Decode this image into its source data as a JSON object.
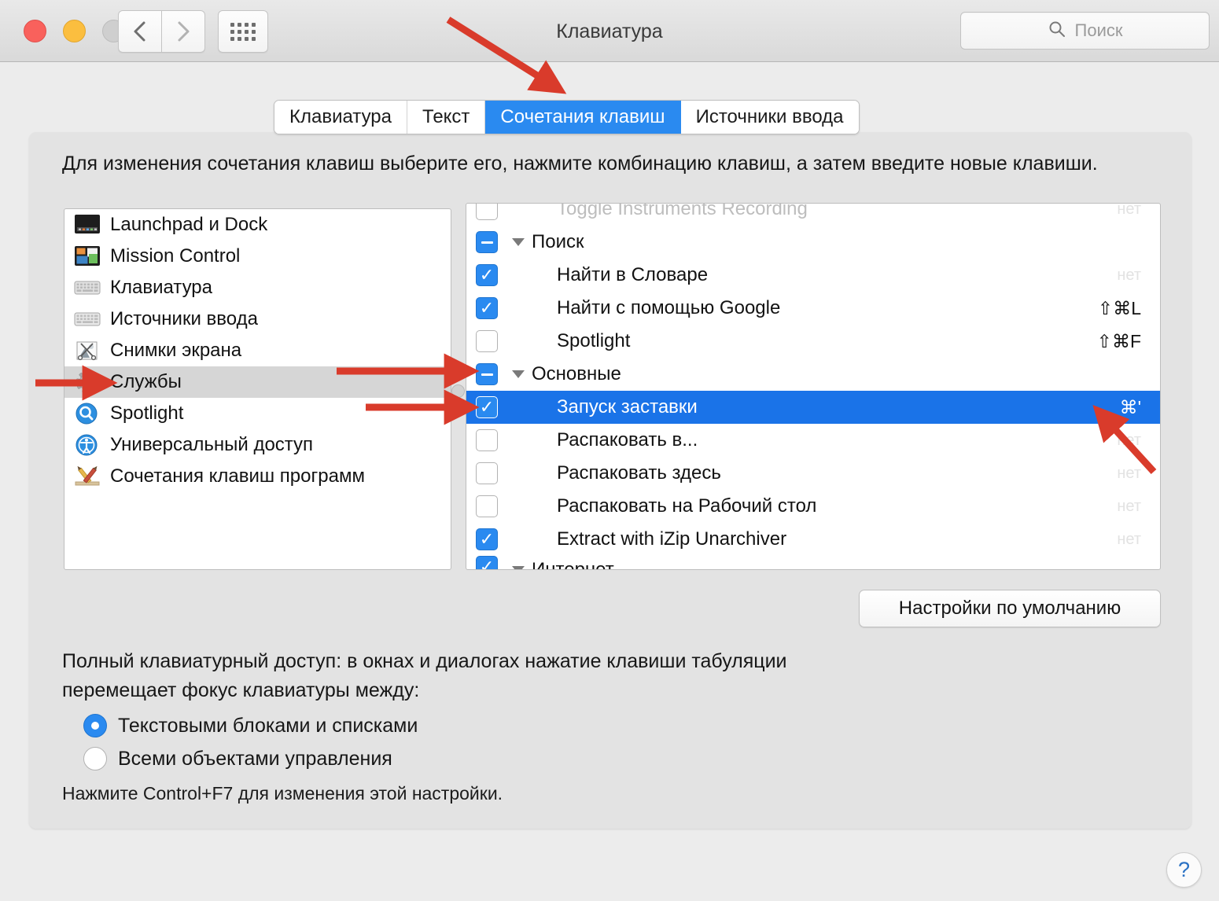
{
  "window": {
    "title": "Клавиатура",
    "traffic_lights": [
      "close",
      "minimize",
      "zoom"
    ],
    "nav": {
      "back": "back-chevron",
      "forward": "forward-chevron",
      "grid": "show-all-grid"
    },
    "search": {
      "placeholder": "Поиск",
      "value": "",
      "icon": "search-icon"
    }
  },
  "tabs": [
    {
      "label": "Клавиатура",
      "active": false
    },
    {
      "label": "Текст",
      "active": false
    },
    {
      "label": "Сочетания клавиш",
      "active": true
    },
    {
      "label": "Источники ввода",
      "active": false
    }
  ],
  "instruction": "Для изменения сочетания клавиш выберите его, нажмите комбинацию клавиш, а затем введите новые клавиши.",
  "categories": [
    {
      "label": "Launchpad и Dock",
      "icon": "launchpad-dock-icon",
      "selected": false
    },
    {
      "label": "Mission Control",
      "icon": "mission-control-icon",
      "selected": false
    },
    {
      "label": "Клавиатура",
      "icon": "keyboard-icon",
      "selected": false
    },
    {
      "label": "Источники ввода",
      "icon": "input-sources-keyboard-icon",
      "selected": false
    },
    {
      "label": "Снимки экрана",
      "icon": "screenshots-icon",
      "selected": false
    },
    {
      "label": "Службы",
      "icon": "services-gear-icon",
      "selected": true
    },
    {
      "label": "Spotlight",
      "icon": "spotlight-magnifier-icon",
      "selected": false
    },
    {
      "label": "Универсальный доступ",
      "icon": "accessibility-icon",
      "selected": false
    },
    {
      "label": "Сочетания клавиш программ",
      "icon": "app-shortcuts-icon",
      "selected": false
    }
  ],
  "shortcuts": {
    "partial_top": {
      "label": "Toggle Instruments Recording",
      "shortcut": "нет",
      "checked": false
    },
    "partial_bottom": {
      "label": "Интернет",
      "checked": true,
      "group": true
    },
    "rows": [
      {
        "type": "group",
        "label": "Поиск",
        "state": "mixed",
        "shortcut": "",
        "selected": false
      },
      {
        "type": "item",
        "label": "Найти в Словаре",
        "state": "on",
        "shortcut": "нет",
        "selected": false
      },
      {
        "type": "item",
        "label": "Найти с помощью Google",
        "state": "on",
        "shortcut": "⇧⌘L",
        "selected": false
      },
      {
        "type": "item",
        "label": "Spotlight",
        "state": "off",
        "shortcut": "⇧⌘F",
        "selected": false
      },
      {
        "type": "group",
        "label": "Основные",
        "state": "mixed",
        "shortcut": "",
        "selected": false
      },
      {
        "type": "item",
        "label": "Запуск заставки",
        "state": "on",
        "shortcut": "⌘'",
        "selected": true
      },
      {
        "type": "item",
        "label": "Распаковать в...",
        "state": "off",
        "shortcut": "нет",
        "selected": false
      },
      {
        "type": "item",
        "label": "Распаковать здесь",
        "state": "off",
        "shortcut": "нет",
        "selected": false
      },
      {
        "type": "item",
        "label": "Распаковать на Рабочий стол",
        "state": "off",
        "shortcut": "нет",
        "selected": false
      },
      {
        "type": "item",
        "label": "Extract with iZip Unarchiver",
        "state": "on",
        "shortcut": "нет",
        "selected": false
      }
    ]
  },
  "defaults_button": "Настройки по умолчанию",
  "full_keyboard_access": {
    "description": "Полный клавиатурный доступ: в окнах и диалогах нажатие клавиши табуляции перемещает фокус клавиатуры между:",
    "options": [
      {
        "label": "Текстовыми блоками и списками",
        "selected": true
      },
      {
        "label": "Всеми объектами управления",
        "selected": false
      }
    ],
    "hint": "Нажмите Control+F7 для изменения этой настройки."
  },
  "help_button": "?",
  "colors": {
    "accent_blue": "#2a8af0",
    "selection_blue": "#1a73e8",
    "annotation_red": "#d93b2b",
    "window_bg": "#ececec",
    "panel_bg": "#e3e3e3"
  }
}
